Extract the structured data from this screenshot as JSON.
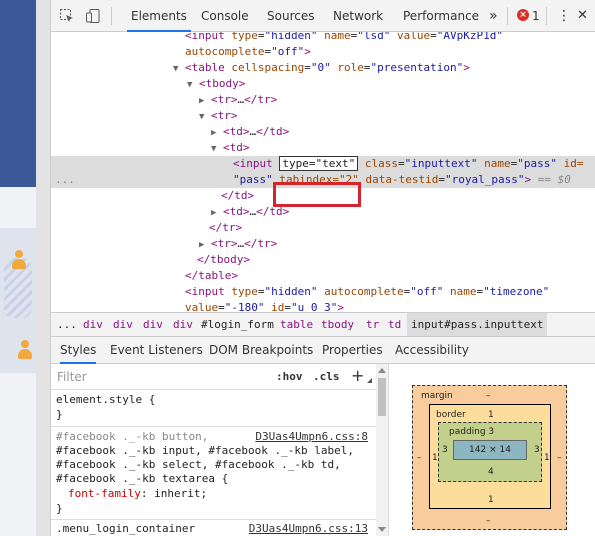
{
  "toolbar": {
    "tabs": [
      "Elements",
      "Console",
      "Sources",
      "Network",
      "Performance"
    ],
    "more": "»",
    "error_count": "1",
    "menu": "⋮",
    "close": "✕"
  },
  "tree": {
    "l1": {
      "open": "<input ",
      "a1": "type",
      "v1": "\"hidden\"",
      "a2": "name",
      "v2": "\"lsd\"",
      "a3": "value",
      "v3": "\"AVpKzP1d\""
    },
    "l2": {
      "a": "autocomplete",
      "v": "\"off\"",
      "close": ">"
    },
    "l3": {
      "tri": "▼",
      "open": "<table ",
      "a1": "cellspacing",
      "v1": "\"0\"",
      "a2": "role",
      "v2": "\"presentation\"",
      "close": ">"
    },
    "l4": {
      "tri": "▼",
      "tag": "<tbody>"
    },
    "l5": {
      "tri": "▶",
      "tag": "<tr>",
      "ell": "…",
      "close": "</tr>"
    },
    "l6": {
      "tri": "▼",
      "tag": "<tr>"
    },
    "l7": {
      "tri": "▶",
      "tag": "<td>",
      "ell": "…",
      "close": "</td>"
    },
    "l8": {
      "tri": "▼",
      "tag": "<td>"
    },
    "l9": {
      "dots": "...",
      "open": "<input",
      "edit": "type=\"text\"",
      "a1": "class",
      "v1": "\"inputtext\"",
      "a2": "name",
      "v2": "\"pass\"",
      "a3": "id="
    },
    "l10": {
      "v1": "\"pass\"",
      "a1": "tabindex=\"2\"",
      "a2": "data-testid",
      "v2": "\"royal_pass\"",
      "close": ">",
      "eq": "== $0"
    },
    "l11": {
      "tag": "</td>"
    },
    "l12": {
      "tri": "▶",
      "tag": "<td>",
      "ell": "…",
      "close": "</td>"
    },
    "l13": {
      "tag": "</tr>"
    },
    "l14": {
      "tri": "▶",
      "tag": "<tr>",
      "ell": "…",
      "close": "</tr>"
    },
    "l15": {
      "tag": "</tbody>"
    },
    "l16": {
      "tag": "</table>"
    },
    "l17": {
      "open": "<input ",
      "a1": "type",
      "v1": "\"hidden\"",
      "a2": "autocomplete",
      "v2": "\"off\"",
      "a3": "name",
      "v3": "\"timezone\""
    },
    "l18": {
      "a1": "value",
      "v1": "\"-180\"",
      "a2": "id",
      "v2": "\"u_0_3\"",
      "close": ">"
    }
  },
  "breadcrumbs": [
    "...",
    "div",
    "div",
    "div",
    "div",
    "#login_form",
    "table",
    "tbody",
    "tr",
    "td",
    "input#pass.inputtext"
  ],
  "styles_tabs": [
    "Styles",
    "Event Listeners",
    "DOM Breakpoints",
    "Properties",
    "Accessibility"
  ],
  "filter": {
    "placeholder": "Filter",
    "hov": ":hov",
    "cls": ".cls",
    "plus": "+"
  },
  "rules": {
    "element_style": "element.style {",
    "close1": "}",
    "r2_sel1": "#facebook ._-kb button,",
    "r2_src": "D3Uas4Umpn6.css:8",
    "r2_sel2": "#facebook ._-kb input, #facebook ._-kb label,",
    "r2_sel3": "#facebook ._-kb select, #facebook ._-kb td,",
    "r2_sel4": "#facebook ._-kb textarea {",
    "r2_prop": "font-family",
    "r2_val": ": inherit;",
    "close2": "}",
    "r3_sel": ".menu_login_container",
    "r3_src": "D3Uas4Umpn6.css:13"
  },
  "box_model": {
    "margin_label": "margin",
    "margin_top": "–",
    "margin_bottom": "–",
    "margin_left": "–",
    "margin_right": "–",
    "border_label": "border",
    "border_top": "1",
    "border_bottom": "1",
    "border_left": "1",
    "border_right": "1",
    "padding_label": "padding 3",
    "padding_bottom": "4",
    "padding_left": "3",
    "padding_right": "3",
    "content": "142 × 14"
  }
}
